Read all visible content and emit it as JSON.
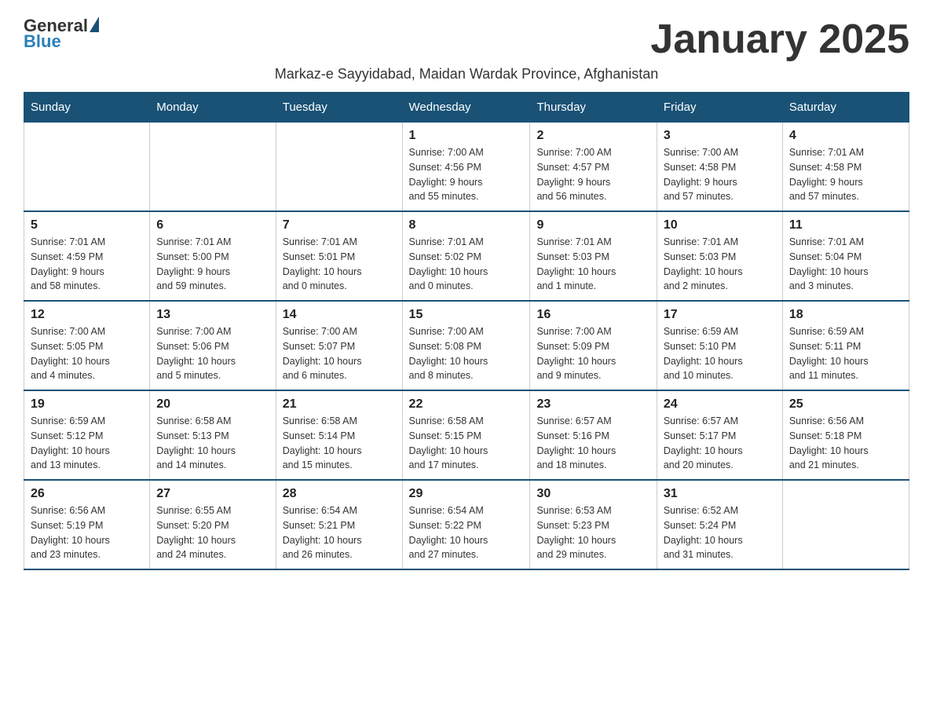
{
  "logo": {
    "general": "General",
    "blue": "Blue"
  },
  "title": "January 2025",
  "subtitle": "Markaz-e Sayyidabad, Maidan Wardak Province, Afghanistan",
  "days_of_week": [
    "Sunday",
    "Monday",
    "Tuesday",
    "Wednesday",
    "Thursday",
    "Friday",
    "Saturday"
  ],
  "weeks": [
    [
      {
        "day": "",
        "info": ""
      },
      {
        "day": "",
        "info": ""
      },
      {
        "day": "",
        "info": ""
      },
      {
        "day": "1",
        "info": "Sunrise: 7:00 AM\nSunset: 4:56 PM\nDaylight: 9 hours\nand 55 minutes."
      },
      {
        "day": "2",
        "info": "Sunrise: 7:00 AM\nSunset: 4:57 PM\nDaylight: 9 hours\nand 56 minutes."
      },
      {
        "day": "3",
        "info": "Sunrise: 7:00 AM\nSunset: 4:58 PM\nDaylight: 9 hours\nand 57 minutes."
      },
      {
        "day": "4",
        "info": "Sunrise: 7:01 AM\nSunset: 4:58 PM\nDaylight: 9 hours\nand 57 minutes."
      }
    ],
    [
      {
        "day": "5",
        "info": "Sunrise: 7:01 AM\nSunset: 4:59 PM\nDaylight: 9 hours\nand 58 minutes."
      },
      {
        "day": "6",
        "info": "Sunrise: 7:01 AM\nSunset: 5:00 PM\nDaylight: 9 hours\nand 59 minutes."
      },
      {
        "day": "7",
        "info": "Sunrise: 7:01 AM\nSunset: 5:01 PM\nDaylight: 10 hours\nand 0 minutes."
      },
      {
        "day": "8",
        "info": "Sunrise: 7:01 AM\nSunset: 5:02 PM\nDaylight: 10 hours\nand 0 minutes."
      },
      {
        "day": "9",
        "info": "Sunrise: 7:01 AM\nSunset: 5:03 PM\nDaylight: 10 hours\nand 1 minute."
      },
      {
        "day": "10",
        "info": "Sunrise: 7:01 AM\nSunset: 5:03 PM\nDaylight: 10 hours\nand 2 minutes."
      },
      {
        "day": "11",
        "info": "Sunrise: 7:01 AM\nSunset: 5:04 PM\nDaylight: 10 hours\nand 3 minutes."
      }
    ],
    [
      {
        "day": "12",
        "info": "Sunrise: 7:00 AM\nSunset: 5:05 PM\nDaylight: 10 hours\nand 4 minutes."
      },
      {
        "day": "13",
        "info": "Sunrise: 7:00 AM\nSunset: 5:06 PM\nDaylight: 10 hours\nand 5 minutes."
      },
      {
        "day": "14",
        "info": "Sunrise: 7:00 AM\nSunset: 5:07 PM\nDaylight: 10 hours\nand 6 minutes."
      },
      {
        "day": "15",
        "info": "Sunrise: 7:00 AM\nSunset: 5:08 PM\nDaylight: 10 hours\nand 8 minutes."
      },
      {
        "day": "16",
        "info": "Sunrise: 7:00 AM\nSunset: 5:09 PM\nDaylight: 10 hours\nand 9 minutes."
      },
      {
        "day": "17",
        "info": "Sunrise: 6:59 AM\nSunset: 5:10 PM\nDaylight: 10 hours\nand 10 minutes."
      },
      {
        "day": "18",
        "info": "Sunrise: 6:59 AM\nSunset: 5:11 PM\nDaylight: 10 hours\nand 11 minutes."
      }
    ],
    [
      {
        "day": "19",
        "info": "Sunrise: 6:59 AM\nSunset: 5:12 PM\nDaylight: 10 hours\nand 13 minutes."
      },
      {
        "day": "20",
        "info": "Sunrise: 6:58 AM\nSunset: 5:13 PM\nDaylight: 10 hours\nand 14 minutes."
      },
      {
        "day": "21",
        "info": "Sunrise: 6:58 AM\nSunset: 5:14 PM\nDaylight: 10 hours\nand 15 minutes."
      },
      {
        "day": "22",
        "info": "Sunrise: 6:58 AM\nSunset: 5:15 PM\nDaylight: 10 hours\nand 17 minutes."
      },
      {
        "day": "23",
        "info": "Sunrise: 6:57 AM\nSunset: 5:16 PM\nDaylight: 10 hours\nand 18 minutes."
      },
      {
        "day": "24",
        "info": "Sunrise: 6:57 AM\nSunset: 5:17 PM\nDaylight: 10 hours\nand 20 minutes."
      },
      {
        "day": "25",
        "info": "Sunrise: 6:56 AM\nSunset: 5:18 PM\nDaylight: 10 hours\nand 21 minutes."
      }
    ],
    [
      {
        "day": "26",
        "info": "Sunrise: 6:56 AM\nSunset: 5:19 PM\nDaylight: 10 hours\nand 23 minutes."
      },
      {
        "day": "27",
        "info": "Sunrise: 6:55 AM\nSunset: 5:20 PM\nDaylight: 10 hours\nand 24 minutes."
      },
      {
        "day": "28",
        "info": "Sunrise: 6:54 AM\nSunset: 5:21 PM\nDaylight: 10 hours\nand 26 minutes."
      },
      {
        "day": "29",
        "info": "Sunrise: 6:54 AM\nSunset: 5:22 PM\nDaylight: 10 hours\nand 27 minutes."
      },
      {
        "day": "30",
        "info": "Sunrise: 6:53 AM\nSunset: 5:23 PM\nDaylight: 10 hours\nand 29 minutes."
      },
      {
        "day": "31",
        "info": "Sunrise: 6:52 AM\nSunset: 5:24 PM\nDaylight: 10 hours\nand 31 minutes."
      },
      {
        "day": "",
        "info": ""
      }
    ]
  ]
}
